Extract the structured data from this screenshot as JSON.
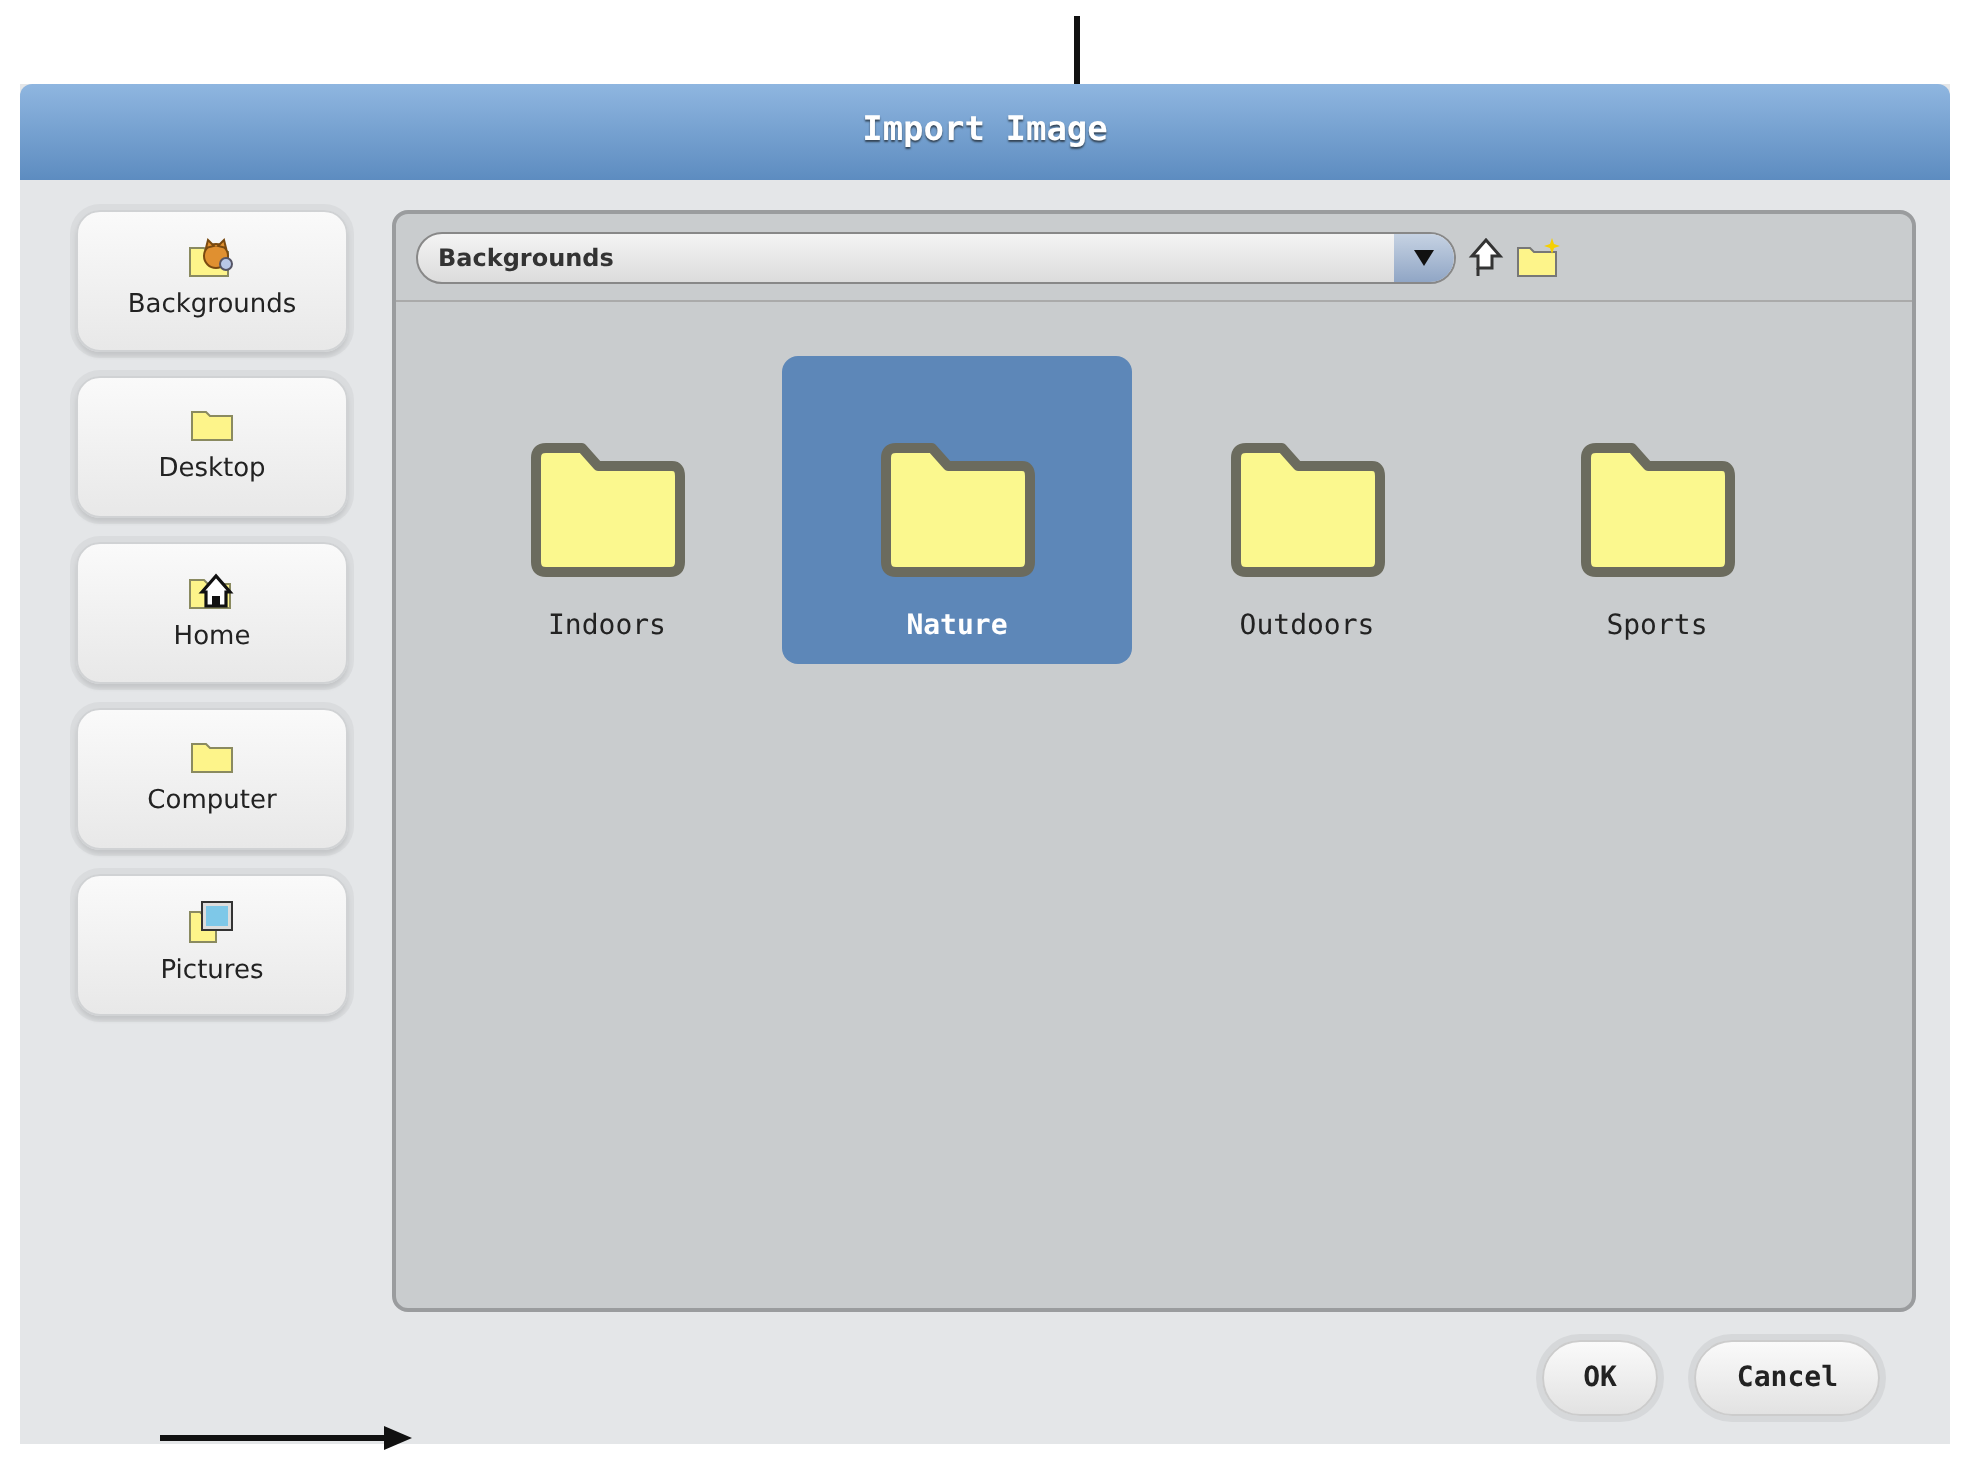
{
  "window": {
    "title": "Import Image"
  },
  "sidebar": {
    "items": [
      {
        "label": "Backgrounds",
        "kind": "theme"
      },
      {
        "label": "Desktop",
        "kind": "folder"
      },
      {
        "label": "Home",
        "kind": "home"
      },
      {
        "label": "Computer",
        "kind": "folder"
      },
      {
        "label": "Pictures",
        "kind": "pictures"
      }
    ]
  },
  "path_bar": {
    "value": "Backgrounds"
  },
  "folders": [
    {
      "label": "Indoors",
      "selected": false
    },
    {
      "label": "Nature",
      "selected": true
    },
    {
      "label": "Outdoors",
      "selected": false
    },
    {
      "label": "Sports",
      "selected": false
    }
  ],
  "buttons": [
    "OK",
    "Cancel"
  ]
}
